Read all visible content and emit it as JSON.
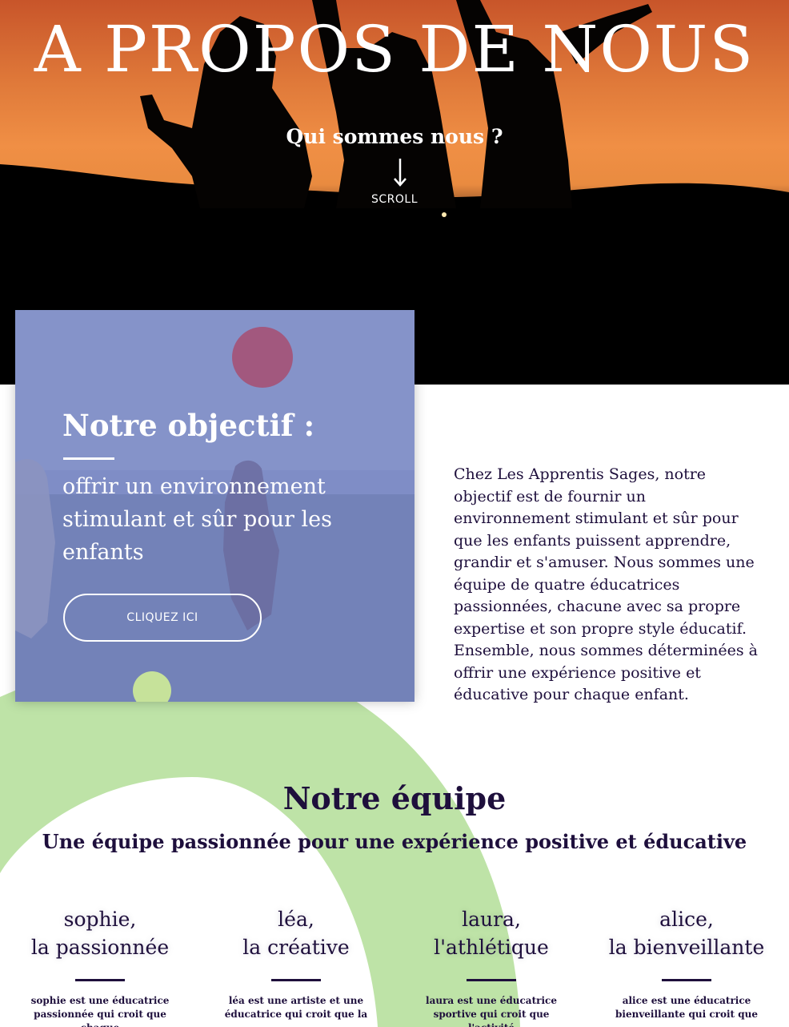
{
  "hero": {
    "title": "A PROPOS DE NOUS",
    "subtitle": "Qui sommes nous ?",
    "scroll_label": "SCROLL"
  },
  "objective": {
    "title": "Notre objectif :",
    "text": "offrir un environnement stimulant et sûr pour les enfants",
    "button_label": "CLIQUEZ ICI"
  },
  "about": {
    "paragraph": "Chez Les Apprentis Sages, notre objectif est de fournir un environnement stimulant et sûr pour que les enfants puissent apprendre, grandir et s'amuser. Nous sommes une équipe de quatre éducatrices passionnées, chacune avec sa propre expertise et son propre style éducatif. Ensemble, nous sommes déterminées à offrir une expérience positive et éducative pour chaque enfant."
  },
  "team": {
    "title": "Notre équipe",
    "subtitle": "Une équipe passionnée pour une expérience positive et éducative",
    "members": [
      {
        "name_line1": "sophie,",
        "name_line2": "la passionnée",
        "desc": "sophie est une éducatrice passionnée qui croit que chaque"
      },
      {
        "name_line1": "léa,",
        "name_line2": "la créative",
        "desc": "léa est une artiste et une éducatrice qui croit que la"
      },
      {
        "name_line1": "laura,",
        "name_line2": "l'athlétique",
        "desc": "laura est une éducatrice sportive qui croit que l'activité"
      },
      {
        "name_line1": "alice,",
        "name_line2": "la bienveillante",
        "desc": "alice est une éducatrice bienveillante qui croit que"
      }
    ]
  },
  "colors": {
    "text_dark": "#1e0f3c",
    "card_overlay": "#7c8ac4",
    "arc_green": "#a8d98a",
    "sunset_orange": "#f08f45"
  }
}
